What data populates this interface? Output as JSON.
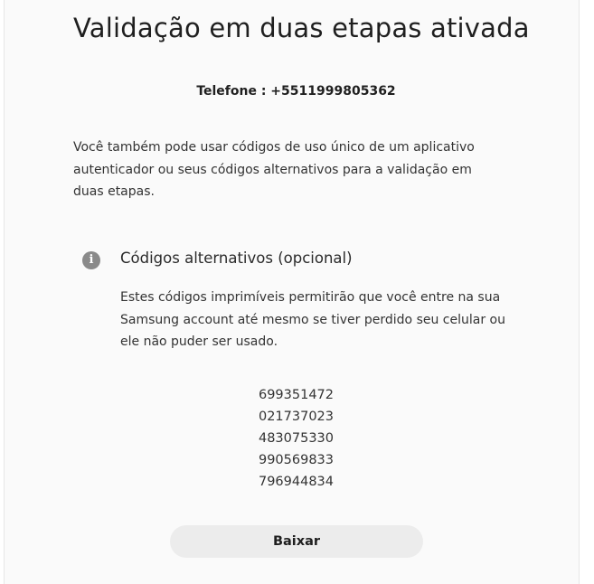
{
  "page": {
    "title": "Validação em duas etapas ativada",
    "phone": "Telefone : +5511999805362",
    "intro": "Você também pode usar códigos de uso único de um aplicativo autenticador ou seus códigos alternativos para a validação em duas etapas."
  },
  "backup_codes": {
    "icon": "info-icon",
    "icon_glyph": "i",
    "title": "Códigos alternativos (opcional)",
    "description": "Estes códigos imprimíveis permitirão que você entre na sua Samsung account até mesmo se tiver perdido seu celular ou ele não puder ser usado.",
    "codes": [
      "699351472",
      "021737023",
      "483075330",
      "990569833",
      "796944834"
    ],
    "download_label": "Baixar"
  },
  "colors": {
    "panel_background": "#fafafa",
    "button_background": "#ececec",
    "icon_color": "#8a8a8a"
  }
}
